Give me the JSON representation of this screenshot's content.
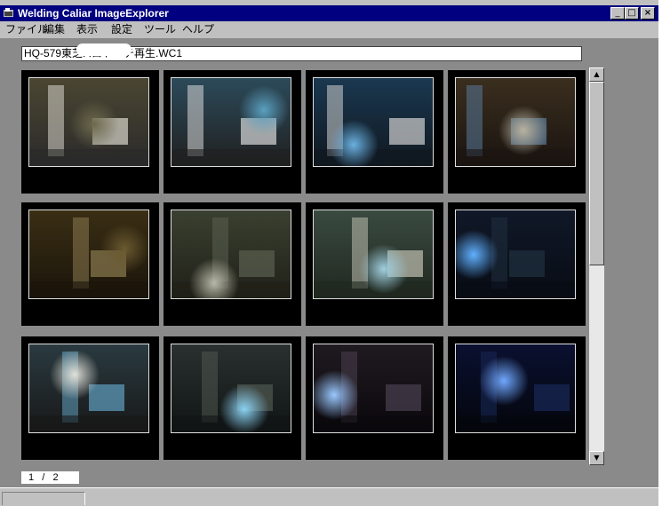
{
  "window": {
    "title": "Welding Caliar ImageExplorer",
    "controls": {
      "minimize": "_",
      "maximize": "□",
      "close": "×"
    }
  },
  "menu": [
    "ファイル",
    "編集",
    "表示",
    "設定",
    "ツール",
    "ヘルプ"
  ],
  "path": {
    "value": "HQ-579東芝.          .ロトーチ再生.WC1"
  },
  "thumbnails": [
    {
      "scene": "operator kneeling beside welding machine and laptop",
      "palette": [
        "#4b4632",
        "#6e6a4e",
        "#d8d6cc",
        "#2a2a2a"
      ]
    },
    {
      "scene": "welding head with laptop on cart, blue glow",
      "palette": [
        "#2c4a5a",
        "#5aa0c0",
        "#d8d8d8",
        "#202020"
      ]
    },
    {
      "scene": "operator with torch and laptop, bright blue arc",
      "palette": [
        "#1a3850",
        "#6ab0e0",
        "#d0d0d0",
        "#101820"
      ]
    },
    {
      "scene": "laptop screen close-up",
      "palette": [
        "#3a2e1e",
        "#b8b2a0",
        "#5a7a9a",
        "#1a1410"
      ]
    },
    {
      "scene": "pipe welding fixture, dark brown",
      "palette": [
        "#3a2e14",
        "#6a5a30",
        "#8a7a50",
        "#1a140a"
      ]
    },
    {
      "scene": "orbital welding head on pipe",
      "palette": [
        "#3a4030",
        "#b8b8a8",
        "#5a6050",
        "#202018"
      ]
    },
    {
      "scene": "welding torch over pipe flange, cyan light",
      "palette": [
        "#3a4a40",
        "#a0d0e0",
        "#c0c0b0",
        "#202820"
      ]
    },
    {
      "scene": "operator with arc flash on floor",
      "palette": [
        "#101828",
        "#60b0ff",
        "#203040",
        "#080c14"
      ]
    },
    {
      "scene": "laptop in foreground, operator behind",
      "palette": [
        "#2a3a40",
        "#e0e0d8",
        "#60a0c0",
        "#181818"
      ]
    },
    {
      "scene": "wide view of welding setup with arc",
      "palette": [
        "#2a3030",
        "#8ad0f0",
        "#505850",
        "#101414"
      ]
    },
    {
      "scene": "bright arc with sparks, dark background",
      "palette": [
        "#201a20",
        "#9ac8ff",
        "#4a4050",
        "#0a080c"
      ]
    },
    {
      "scene": "blue arc glow in darkness",
      "palette": [
        "#0a1030",
        "#70a8ff",
        "#1a2858",
        "#04060c"
      ]
    }
  ],
  "pager": {
    "text": "1   /   2"
  },
  "colors": {
    "titlebar": "#000080",
    "client": "#8a8a8a",
    "face": "#c0c0c0"
  }
}
